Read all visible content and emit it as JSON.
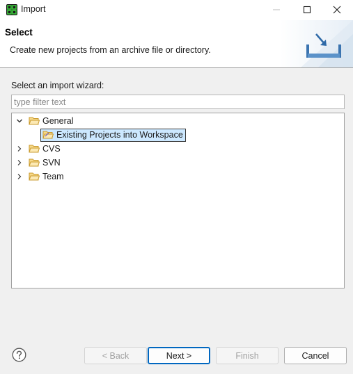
{
  "window": {
    "title": "Import",
    "app_icon": "eclipse-app-icon"
  },
  "banner": {
    "title": "Select",
    "description": "Create new projects from an archive file or directory.",
    "icon": "import-wizard-icon"
  },
  "wizard": {
    "label": "Select an import wizard:",
    "filter_placeholder": "type filter text",
    "filter_value": ""
  },
  "tree": [
    {
      "label": "General",
      "expanded": true,
      "level": 0
    },
    {
      "label": "Existing Projects into Workspace",
      "level": 1,
      "selected": true
    },
    {
      "label": "CVS",
      "expanded": false,
      "level": 0
    },
    {
      "label": "SVN",
      "expanded": false,
      "level": 0
    },
    {
      "label": "Team",
      "expanded": false,
      "level": 0
    }
  ],
  "buttons": {
    "back": "< Back",
    "next": "Next >",
    "finish": "Finish",
    "cancel": "Cancel"
  },
  "colors": {
    "selection": "#cce8ff",
    "folder": "#e8b84a",
    "default_button_border": "#0067c0",
    "banner_bg": "#ffffff",
    "dialog_bg": "#f0f0f0"
  }
}
